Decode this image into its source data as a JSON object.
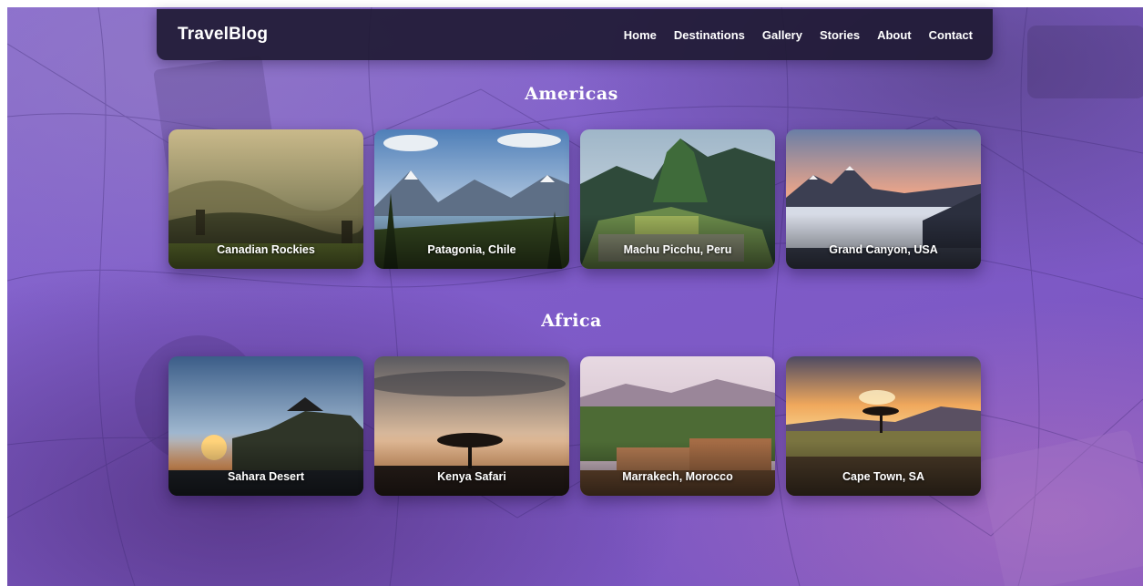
{
  "nav": {
    "brand": "TravelBlog",
    "links": [
      "Home",
      "Destinations",
      "Gallery",
      "Stories",
      "About",
      "Contact"
    ]
  },
  "sections": [
    {
      "title": "Americas",
      "cards": [
        "Canadian Rockies",
        "Patagonia, Chile",
        "Machu Picchu, Peru",
        "Grand Canyon, USA"
      ]
    },
    {
      "title": "Africa",
      "cards": [
        "Sahara Desert",
        "Kenya Safari",
        "Marrakech, Morocco",
        "Cape Town, SA"
      ]
    }
  ],
  "colors": {
    "background": "#7f5cc9",
    "navbar": "#201a34",
    "text": "#ffffff"
  }
}
